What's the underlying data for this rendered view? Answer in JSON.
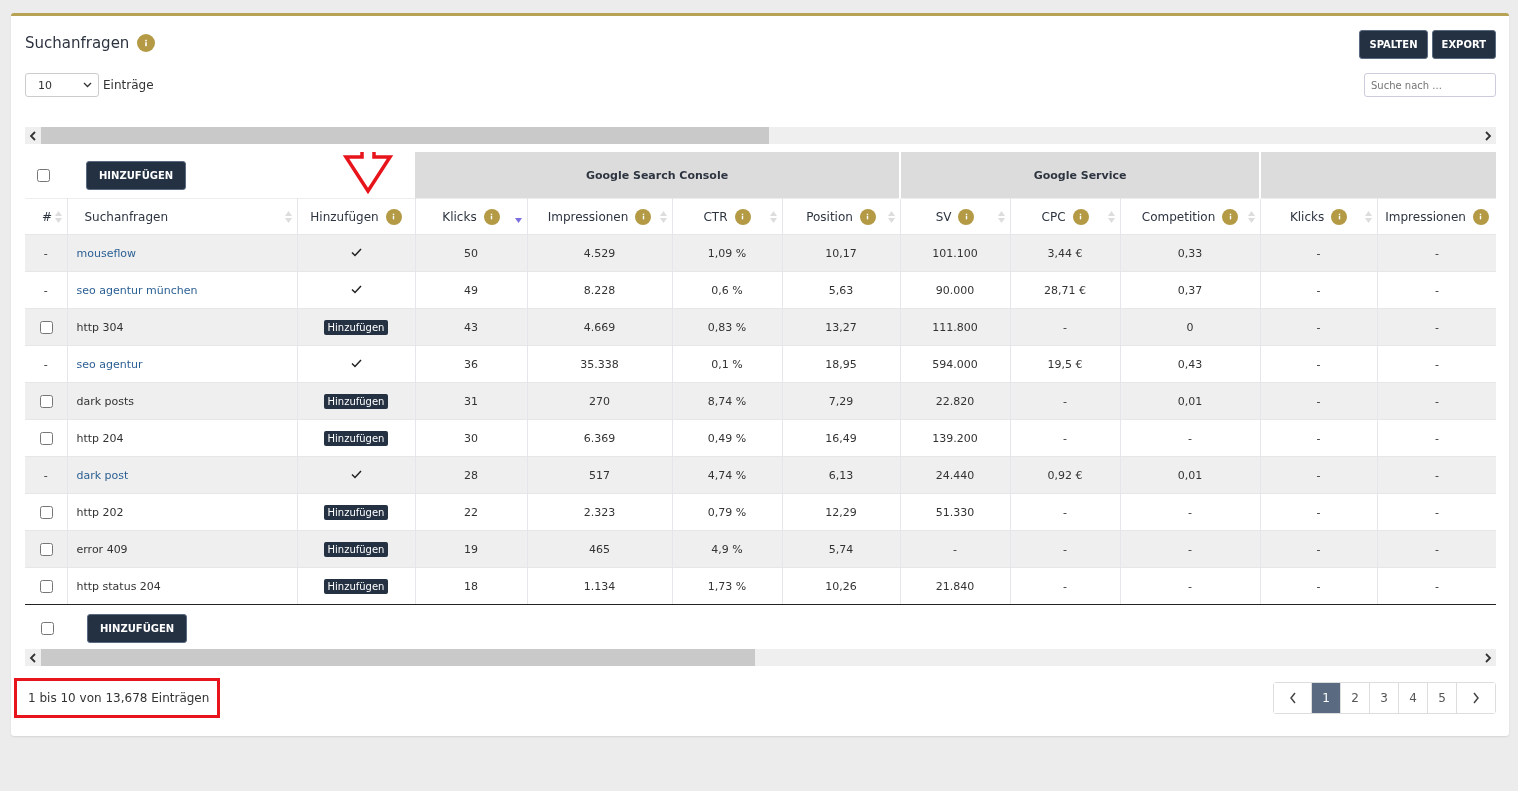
{
  "title": "Suchanfragen",
  "buttons": [
    "SPALTEN",
    "EXPORT"
  ],
  "page_size": {
    "value": "10",
    "label": "Einträge"
  },
  "search": {
    "placeholder": "Suche nach ..."
  },
  "bulk_button_top": "HINZUFÜGEN",
  "bulk_button_bottom": "HINZUFÜGEN",
  "column_groups": [
    {
      "label": "Google Search Console"
    },
    {
      "label": "Google Service"
    }
  ],
  "columns": [
    {
      "label": "#",
      "info": false,
      "sortable": true,
      "sorted": false
    },
    {
      "label": "Suchanfragen",
      "info": false,
      "sortable": true,
      "sorted": false
    },
    {
      "label": "Hinzufügen",
      "info": true,
      "sortable": false,
      "sorted": false
    },
    {
      "label": "Klicks",
      "info": true,
      "sortable": true,
      "sorted": true
    },
    {
      "label": "Impressionen",
      "info": true,
      "sortable": true,
      "sorted": false
    },
    {
      "label": "CTR",
      "info": true,
      "sortable": true,
      "sorted": false
    },
    {
      "label": "Position",
      "info": true,
      "sortable": true,
      "sorted": false
    },
    {
      "label": "SV",
      "info": true,
      "sortable": true,
      "sorted": false
    },
    {
      "label": "CPC",
      "info": true,
      "sortable": true,
      "sorted": false
    },
    {
      "label": "Competition",
      "info": true,
      "sortable": true,
      "sorted": false
    },
    {
      "label": "Klicks",
      "info": true,
      "sortable": true,
      "sorted": false
    },
    {
      "label": "Impressionen",
      "info": true,
      "sortable": false,
      "sorted": false
    }
  ],
  "rows": [
    {
      "kind": "added",
      "marker": "-",
      "query": "mouseflow",
      "cells": [
        "50",
        "4.529",
        "1,09 %",
        "10,17",
        "101.100",
        "3,44 €",
        "0,33",
        "-",
        "-"
      ]
    },
    {
      "kind": "added",
      "marker": "-",
      "query": "seo agentur münchen",
      "cells": [
        "49",
        "8.228",
        "0,6 %",
        "5,63",
        "90.000",
        "28,71 €",
        "0,37",
        "-",
        "-"
      ]
    },
    {
      "kind": "new",
      "checked": false,
      "query": "http 304",
      "action": "Hinzufügen",
      "cells": [
        "43",
        "4.669",
        "0,83 %",
        "13,27",
        "111.800",
        "-",
        "0",
        "-",
        "-"
      ]
    },
    {
      "kind": "added",
      "marker": "-",
      "query": "seo agentur",
      "cells": [
        "36",
        "35.338",
        "0,1 %",
        "18,95",
        "594.000",
        "19,5 €",
        "0,43",
        "-",
        "-"
      ]
    },
    {
      "kind": "new",
      "checked": false,
      "query": "dark posts",
      "action": "Hinzufügen",
      "cells": [
        "31",
        "270",
        "8,74 %",
        "7,29",
        "22.820",
        "-",
        "0,01",
        "-",
        "-"
      ]
    },
    {
      "kind": "new",
      "checked": false,
      "query": "http 204",
      "action": "Hinzufügen",
      "cells": [
        "30",
        "6.369",
        "0,49 %",
        "16,49",
        "139.200",
        "-",
        "-",
        "-",
        "-"
      ]
    },
    {
      "kind": "added",
      "marker": "-",
      "query": "dark post",
      "cells": [
        "28",
        "517",
        "4,74 %",
        "6,13",
        "24.440",
        "0,92 €",
        "0,01",
        "-",
        "-"
      ]
    },
    {
      "kind": "new",
      "checked": false,
      "query": "http 202",
      "action": "Hinzufügen",
      "cells": [
        "22",
        "2.323",
        "0,79 %",
        "12,29",
        "51.330",
        "-",
        "-",
        "-",
        "-"
      ]
    },
    {
      "kind": "new",
      "checked": false,
      "query": "error 409",
      "action": "Hinzufügen",
      "cells": [
        "19",
        "465",
        "4,9 %",
        "5,74",
        "-",
        "-",
        "-",
        "-",
        "-"
      ]
    },
    {
      "kind": "new",
      "checked": false,
      "query": "http status 204",
      "action": "Hinzufügen",
      "cells": [
        "18",
        "1.134",
        "1,73 %",
        "10,26",
        "21.840",
        "-",
        "-",
        "-",
        "-"
      ]
    }
  ],
  "select_all_top": {
    "checked": false
  },
  "select_all_bottom": {
    "checked": false
  },
  "summary": "1 bis 10 von 13,678 Einträgen",
  "pagination": [
    {
      "label": "1",
      "selected": true
    },
    {
      "label": "2",
      "selected": false
    },
    {
      "label": "3",
      "selected": false
    },
    {
      "label": "4",
      "selected": false
    },
    {
      "label": "5",
      "selected": false
    }
  ]
}
